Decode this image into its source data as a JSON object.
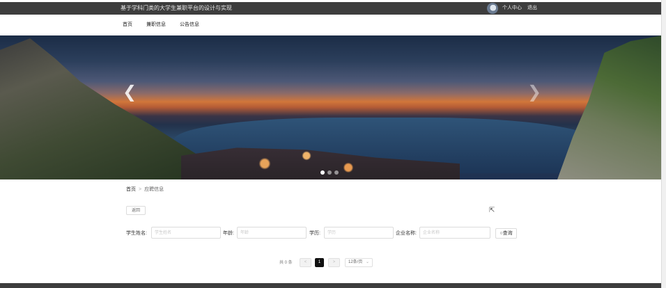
{
  "header": {
    "site_title": "基于学科门类的大学生兼职平台的设计与实现",
    "personal_center": "个人中心",
    "logout": "退出"
  },
  "nav": {
    "items": [
      {
        "label": "首页"
      },
      {
        "label": "兼职信息"
      },
      {
        "label": "公告信息"
      }
    ]
  },
  "banner": {
    "prev_icon": "chevron-left-icon",
    "next_icon": "chevron-right-icon",
    "slides": 3,
    "active_slide": 1
  },
  "breadcrumb": {
    "home": "首页",
    "current": "应聘信息"
  },
  "actions": {
    "back_label": "返回"
  },
  "filters": {
    "student_name": {
      "label": "学生姓名:",
      "placeholder": "学生姓名"
    },
    "age": {
      "label": "年龄:",
      "placeholder": "年龄"
    },
    "education": {
      "label": "学历:",
      "placeholder": "学历"
    },
    "company_name": {
      "label": "企业名称:",
      "placeholder": "企业名称"
    },
    "search_label": "查询"
  },
  "pagination": {
    "total_text": "共 0 条",
    "prev": "<",
    "current_page": "1",
    "next": ">",
    "page_size": "12条/页"
  },
  "colors": {
    "topbar": "#3d3d3d",
    "active_page": "#111111"
  }
}
